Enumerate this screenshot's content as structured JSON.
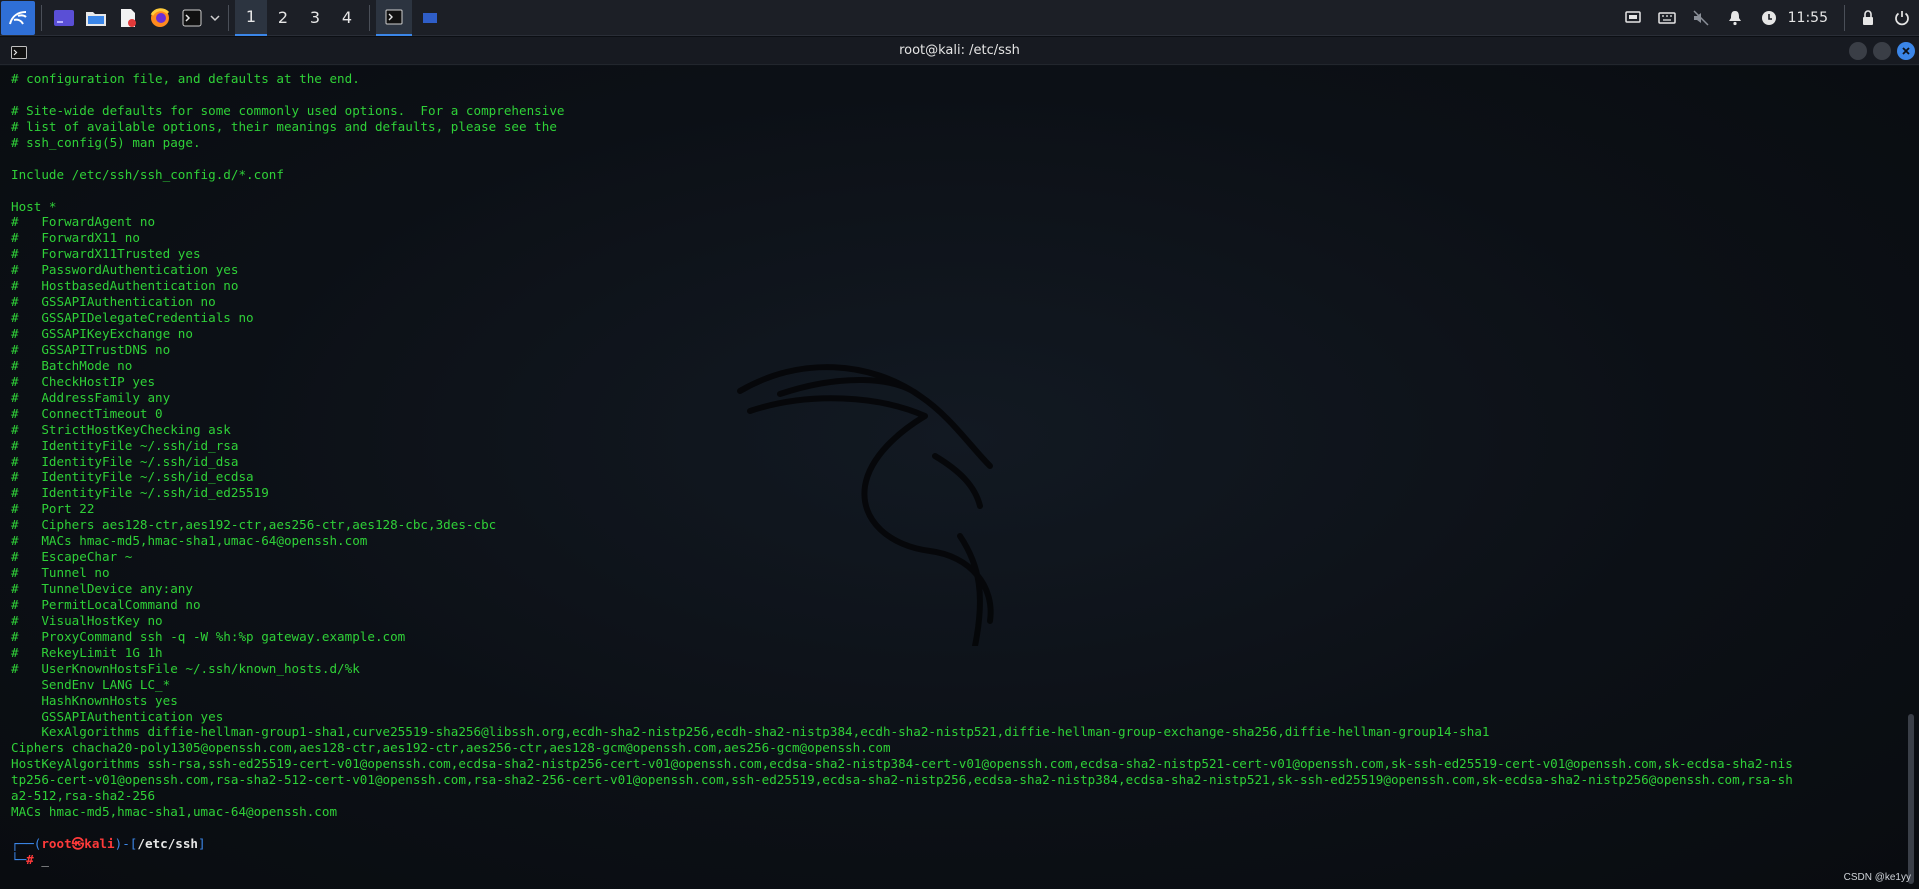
{
  "panel": {
    "workspaces": [
      "1",
      "2",
      "3",
      "4"
    ],
    "active_workspace": "1",
    "clock": "11:55",
    "launchers": [
      "kali-menu-icon",
      "show-desktop-icon",
      "file-manager-icon",
      "text-editor-icon",
      "firefox-icon",
      "terminal-icon",
      "chevron-down-icon"
    ],
    "tray": [
      "display-icon",
      "keyboard-icon",
      "volume-muted-icon",
      "notification-bell-icon",
      "updates-icon",
      "lock-icon",
      "power-icon"
    ]
  },
  "window": {
    "title": "root@kali: /etc/ssh",
    "watermark": "CSDN @ke1yy"
  },
  "terminal": {
    "lines": [
      "# configuration file, and defaults at the end.",
      "",
      "# Site-wide defaults for some commonly used options.  For a comprehensive",
      "# list of available options, their meanings and defaults, please see the",
      "# ssh_config(5) man page.",
      "",
      "Include /etc/ssh/ssh_config.d/*.conf",
      "",
      "Host *",
      "#   ForwardAgent no",
      "#   ForwardX11 no",
      "#   ForwardX11Trusted yes",
      "#   PasswordAuthentication yes",
      "#   HostbasedAuthentication no",
      "#   GSSAPIAuthentication no",
      "#   GSSAPIDelegateCredentials no",
      "#   GSSAPIKeyExchange no",
      "#   GSSAPITrustDNS no",
      "#   BatchMode no",
      "#   CheckHostIP yes",
      "#   AddressFamily any",
      "#   ConnectTimeout 0",
      "#   StrictHostKeyChecking ask",
      "#   IdentityFile ~/.ssh/id_rsa",
      "#   IdentityFile ~/.ssh/id_dsa",
      "#   IdentityFile ~/.ssh/id_ecdsa",
      "#   IdentityFile ~/.ssh/id_ed25519",
      "#   Port 22",
      "#   Ciphers aes128-ctr,aes192-ctr,aes256-ctr,aes128-cbc,3des-cbc",
      "#   MACs hmac-md5,hmac-sha1,umac-64@openssh.com",
      "#   EscapeChar ~",
      "#   Tunnel no",
      "#   TunnelDevice any:any",
      "#   PermitLocalCommand no",
      "#   VisualHostKey no",
      "#   ProxyCommand ssh -q -W %h:%p gateway.example.com",
      "#   RekeyLimit 1G 1h",
      "#   UserKnownHostsFile ~/.ssh/known_hosts.d/%k",
      "    SendEnv LANG LC_*",
      "    HashKnownHosts yes",
      "    GSSAPIAuthentication yes",
      "    KexAlgorithms diffie-hellman-group1-sha1,curve25519-sha256@libssh.org,ecdh-sha2-nistp256,ecdh-sha2-nistp384,ecdh-sha2-nistp521,diffie-hellman-group-exchange-sha256,diffie-hellman-group14-sha1",
      "Ciphers chacha20-poly1305@openssh.com,aes128-ctr,aes192-ctr,aes256-ctr,aes128-gcm@openssh.com,aes256-gcm@openssh.com",
      "HostKeyAlgorithms ssh-rsa,ssh-ed25519-cert-v01@openssh.com,ecdsa-sha2-nistp256-cert-v01@openssh.com,ecdsa-sha2-nistp384-cert-v01@openssh.com,ecdsa-sha2-nistp521-cert-v01@openssh.com,sk-ssh-ed25519-cert-v01@openssh.com,sk-ecdsa-sha2-nis",
      "tp256-cert-v01@openssh.com,rsa-sha2-512-cert-v01@openssh.com,rsa-sha2-256-cert-v01@openssh.com,ssh-ed25519,ecdsa-sha2-nistp256,ecdsa-sha2-nistp384,ecdsa-sha2-nistp521,sk-ssh-ed25519@openssh.com,sk-ecdsa-sha2-nistp256@openssh.com,rsa-sh",
      "a2-512,rsa-sha2-256",
      "MACs hmac-md5,hmac-sha1,umac-64@openssh.com",
      ""
    ],
    "prompt": {
      "open": "┌──(",
      "user": "root㉿kali",
      "mid": ")-[",
      "path": "/etc/ssh",
      "close": "]",
      "line2_prefix": "└─",
      "symbol": "#",
      "cursor": "_"
    }
  }
}
